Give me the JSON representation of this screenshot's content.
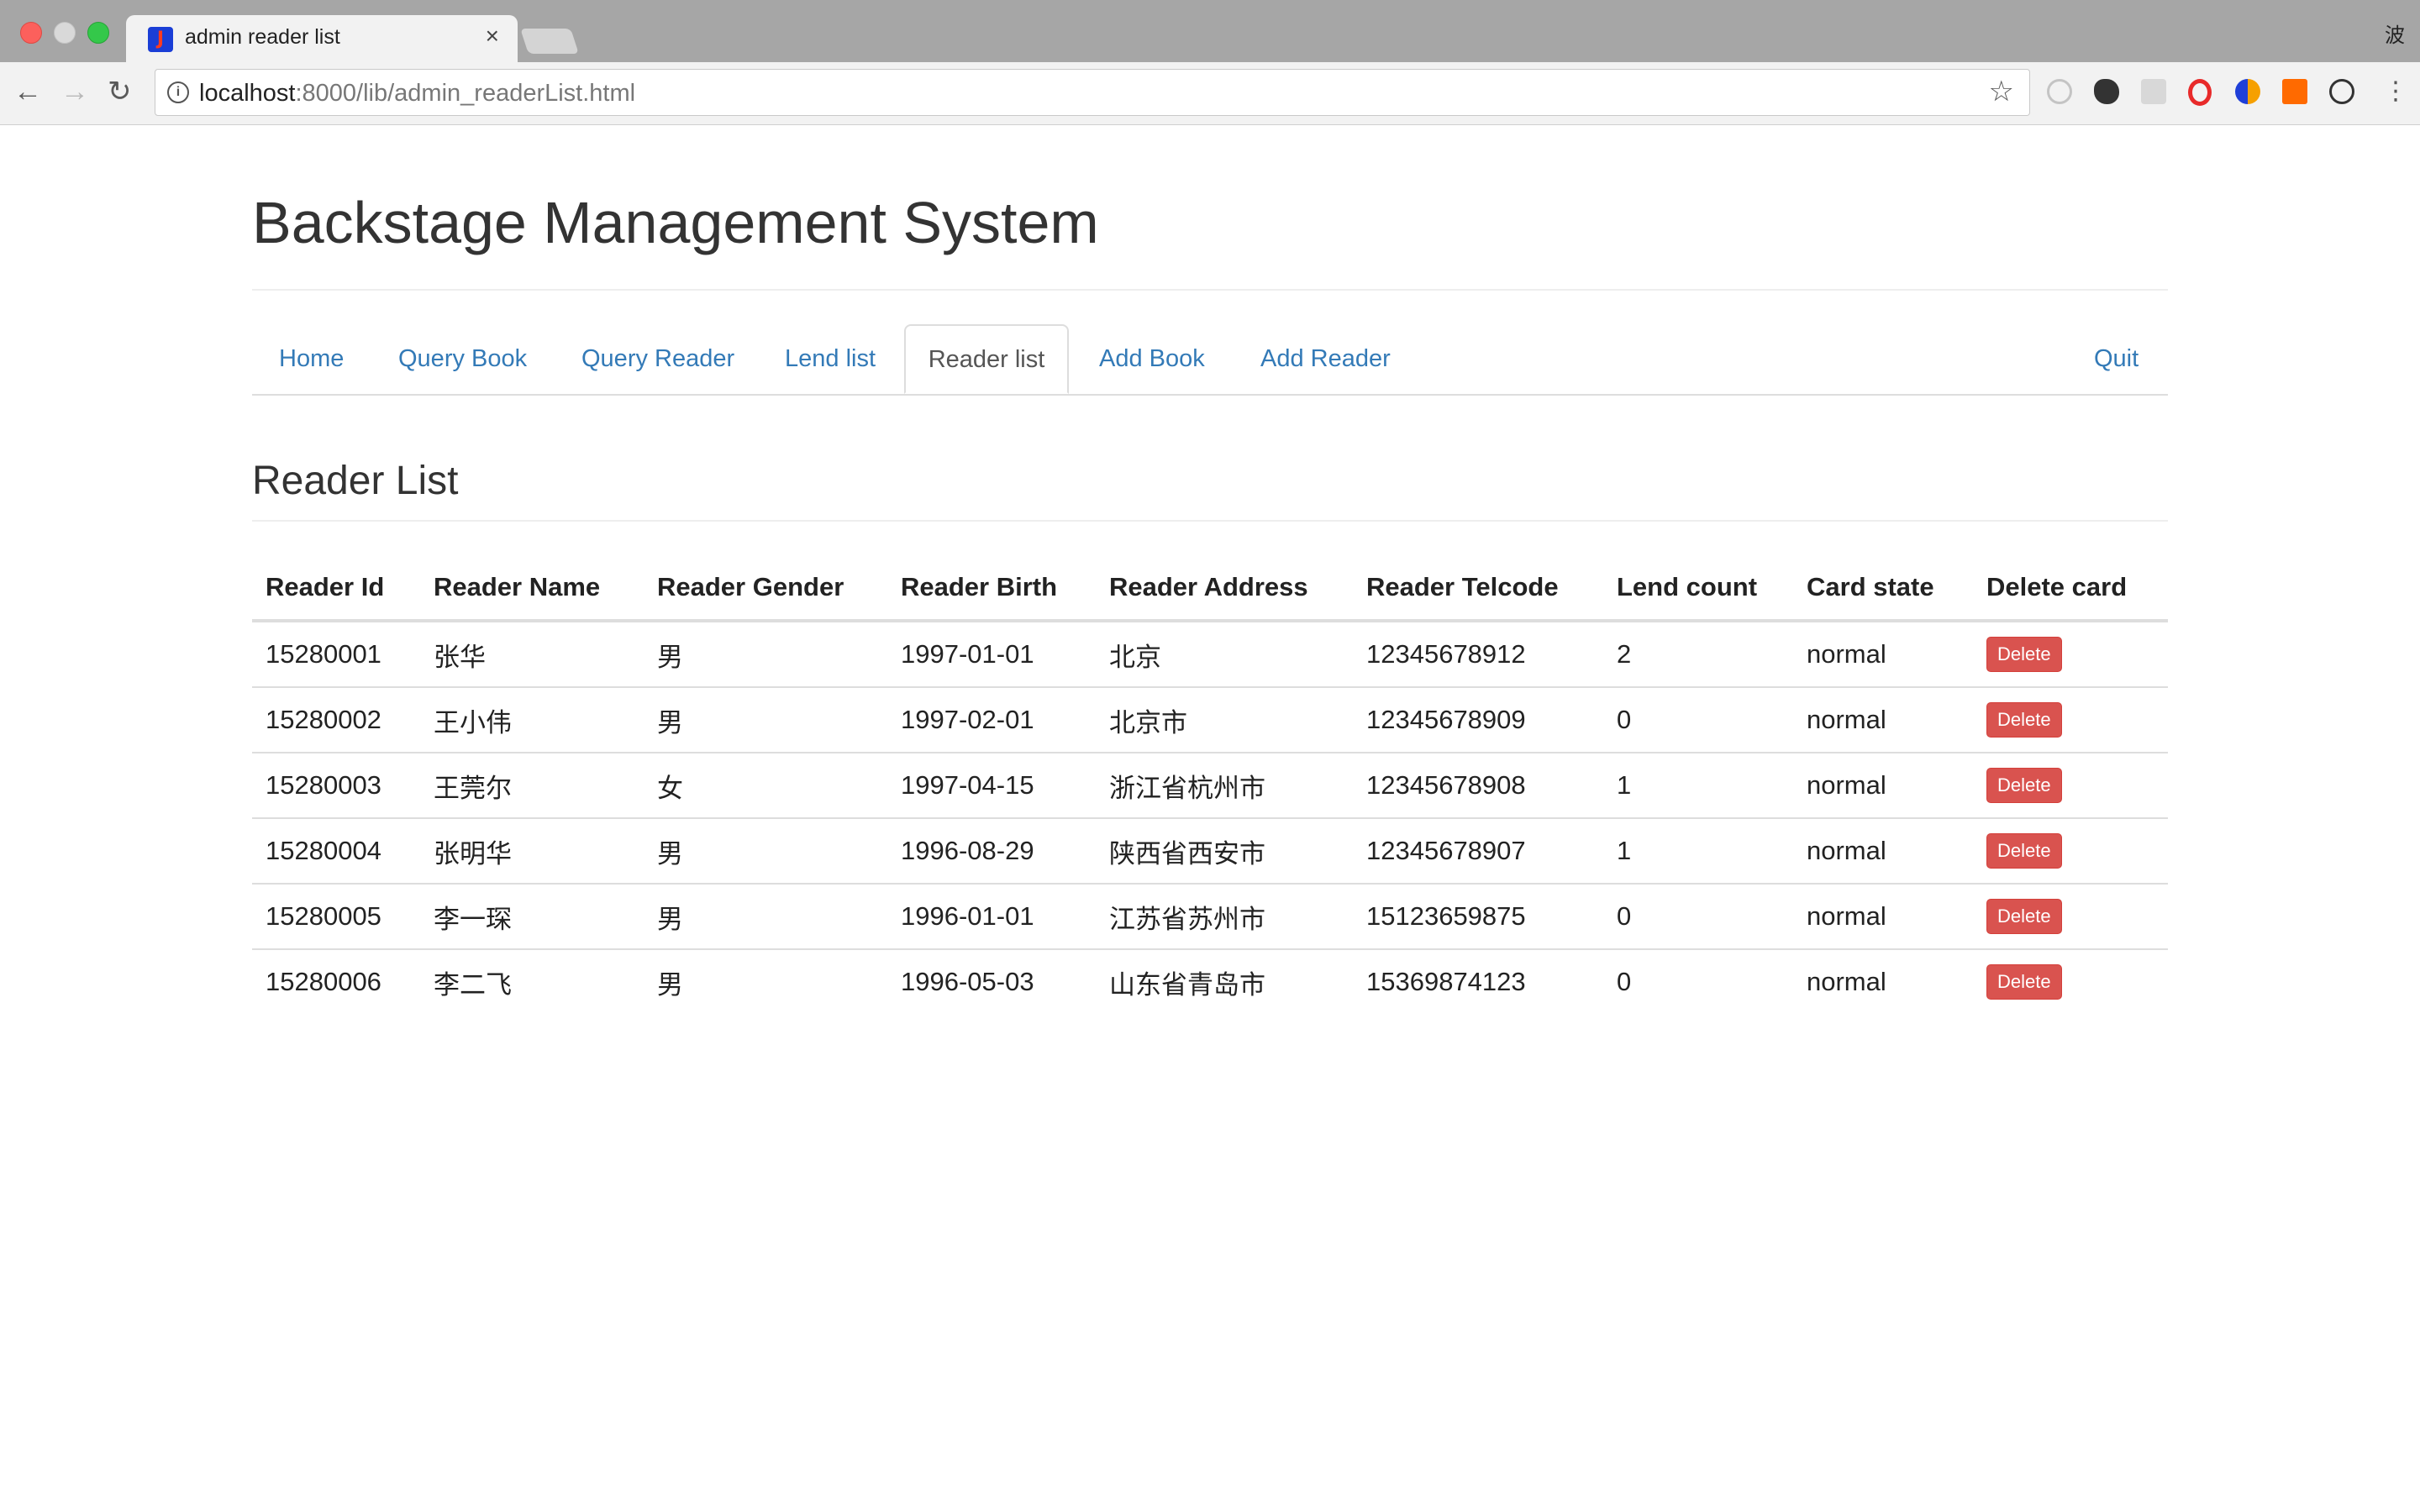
{
  "browser": {
    "tab_title": "admin reader list",
    "tab_close": "×",
    "url_host": "localhost",
    "url_rest": ":8000/lib/admin_readerList.html",
    "profile_char": "波"
  },
  "page": {
    "title": "Backstage Management System",
    "nav": [
      {
        "label": "Home"
      },
      {
        "label": "Query Book"
      },
      {
        "label": "Query Reader"
      },
      {
        "label": "Lend list"
      },
      {
        "label": "Reader list",
        "active": true
      },
      {
        "label": "Add Book"
      },
      {
        "label": "Add Reader"
      }
    ],
    "quit_label": "Quit",
    "section_title": "Reader List",
    "table": {
      "headers": [
        "Reader Id",
        "Reader Name",
        "Reader Gender",
        "Reader Birth",
        "Reader Address",
        "Reader Telcode",
        "Lend count",
        "Card state",
        "Delete card"
      ],
      "rows": [
        [
          "15280001",
          "张华",
          "男",
          "1997-01-01",
          "北京",
          "12345678912",
          "2",
          "normal",
          "Delete"
        ],
        [
          "15280002",
          "王小伟",
          "男",
          "1997-02-01",
          "北京市",
          "12345678909",
          "0",
          "normal",
          "Delete"
        ],
        [
          "15280003",
          "王莞尔",
          "女",
          "1997-04-15",
          "浙江省杭州市",
          "12345678908",
          "1",
          "normal",
          "Delete"
        ],
        [
          "15280004",
          "张明华",
          "男",
          "1996-08-29",
          "陕西省西安市",
          "12345678907",
          "1",
          "normal",
          "Delete"
        ],
        [
          "15280005",
          "李一琛",
          "男",
          "1996-01-01",
          "江苏省苏州市",
          "15123659875",
          "0",
          "normal",
          "Delete"
        ],
        [
          "15280006",
          "李二飞",
          "男",
          "1996-05-03",
          "山东省青岛市",
          "15369874123",
          "0",
          "normal",
          "Delete"
        ]
      ]
    }
  },
  "colors": {
    "link": "#337ab7",
    "danger": "#d9534f",
    "text": "#333333"
  }
}
